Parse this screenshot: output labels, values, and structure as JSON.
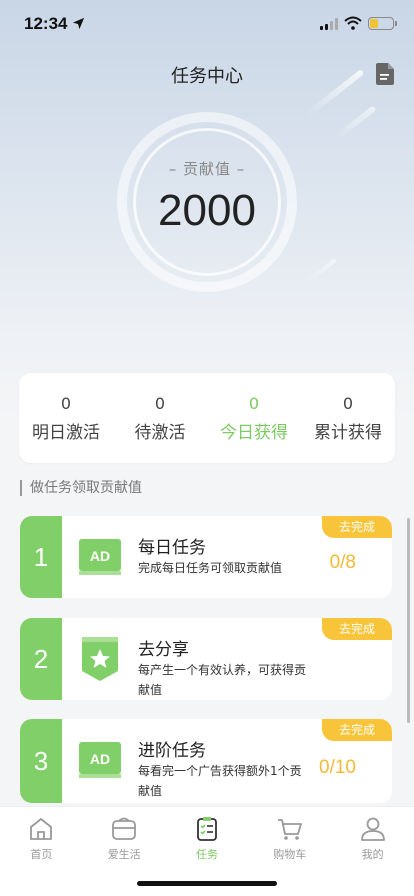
{
  "status_bar": {
    "time": "12:34"
  },
  "header": {
    "title": "任务中心"
  },
  "contribution": {
    "label": "– 贡献值 –",
    "value": "2000"
  },
  "stats": [
    {
      "value": "0",
      "label": "明日激活",
      "active": false
    },
    {
      "value": "0",
      "label": "待激活",
      "active": false
    },
    {
      "value": "0",
      "label": "今日获得",
      "active": true
    },
    {
      "value": "0",
      "label": "累计获得",
      "active": false
    }
  ],
  "section_title": "做任务领取贡献值",
  "tasks": [
    {
      "num": "1",
      "icon": "ad-icon",
      "icon_text": "AD",
      "title": "每日任务",
      "desc": "完成每日任务可领取贡献值",
      "progress": "0/8",
      "badge": "去完成"
    },
    {
      "num": "2",
      "icon": "share-star-icon",
      "title": "去分享",
      "desc": "每产生一个有效认养，可获得贡献值",
      "progress": "",
      "badge": "去完成"
    },
    {
      "num": "3",
      "icon": "ad-icon",
      "icon_text": "AD",
      "title": "进阶任务",
      "desc": "每看完一个广告获得额外1个贡献值",
      "progress": "0/10",
      "badge": "去完成"
    }
  ],
  "tabbar": [
    {
      "label": "首页",
      "icon": "home-icon",
      "active": false
    },
    {
      "label": "爱生活",
      "icon": "life-bag-icon",
      "active": false
    },
    {
      "label": "任务",
      "icon": "task-list-icon",
      "active": true
    },
    {
      "label": "购物车",
      "icon": "cart-icon",
      "active": false
    },
    {
      "label": "我的",
      "icon": "profile-icon",
      "active": false
    }
  ],
  "colors": {
    "accent_green": "#80cf68",
    "badge_yellow": "#f8c43a",
    "progress_yellow": "#f5b935"
  }
}
